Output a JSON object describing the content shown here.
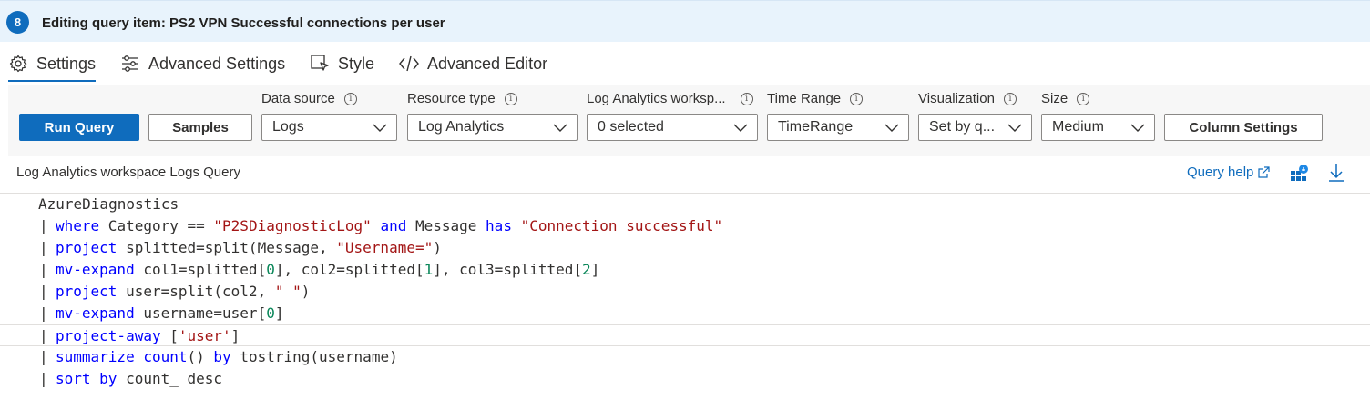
{
  "header": {
    "step": "8",
    "title": "Editing query item: PS2 VPN Successful connections per user"
  },
  "tabs": [
    {
      "label": "Settings",
      "icon": "gear-icon",
      "active": true
    },
    {
      "label": "Advanced Settings",
      "icon": "sliders-icon",
      "active": false
    },
    {
      "label": "Style",
      "icon": "cursor-box-icon",
      "active": false
    },
    {
      "label": "Advanced Editor",
      "icon": "code-icon",
      "active": false
    }
  ],
  "toolbar": {
    "run_label": "Run Query",
    "samples_label": "Samples",
    "column_settings_label": "Column Settings",
    "fields": [
      {
        "label": "Data source",
        "value": "Logs"
      },
      {
        "label": "Resource type",
        "value": "Log Analytics"
      },
      {
        "label": "Log Analytics worksp...",
        "value": "0 selected"
      },
      {
        "label": "Time Range",
        "value": "TimeRange"
      },
      {
        "label": "Visualization",
        "value": "Set by q..."
      },
      {
        "label": "Size",
        "value": "Medium"
      }
    ]
  },
  "query": {
    "title": "Log Analytics workspace Logs Query",
    "help_label": "Query help",
    "lines": [
      {
        "pipe": "",
        "tokens": [
          {
            "t": "AzureDiagnostics",
            "c": ""
          }
        ]
      },
      {
        "pipe": "|",
        "tokens": [
          {
            "t": "where",
            "c": "kw"
          },
          {
            "t": " Category == ",
            "c": ""
          },
          {
            "t": "\"P2SDiagnosticLog\"",
            "c": "str"
          },
          {
            "t": " ",
            "c": ""
          },
          {
            "t": "and",
            "c": "kw"
          },
          {
            "t": " Message ",
            "c": ""
          },
          {
            "t": "has",
            "c": "kw"
          },
          {
            "t": " ",
            "c": ""
          },
          {
            "t": "\"Connection successful\"",
            "c": "str"
          }
        ]
      },
      {
        "pipe": "|",
        "tokens": [
          {
            "t": "project",
            "c": "kw"
          },
          {
            "t": " splitted=split(Message, ",
            "c": ""
          },
          {
            "t": "\"Username=\"",
            "c": "str"
          },
          {
            "t": ")",
            "c": ""
          }
        ]
      },
      {
        "pipe": "|",
        "tokens": [
          {
            "t": "mv-expand",
            "c": "kw"
          },
          {
            "t": " col1=splitted[",
            "c": ""
          },
          {
            "t": "0",
            "c": "num"
          },
          {
            "t": "], col2=splitted[",
            "c": ""
          },
          {
            "t": "1",
            "c": "num"
          },
          {
            "t": "], col3=splitted[",
            "c": ""
          },
          {
            "t": "2",
            "c": "num"
          },
          {
            "t": "]",
            "c": ""
          }
        ]
      },
      {
        "pipe": "|",
        "tokens": [
          {
            "t": "project",
            "c": "kw"
          },
          {
            "t": " user=split(col2, ",
            "c": ""
          },
          {
            "t": "\" \"",
            "c": "str"
          },
          {
            "t": ")",
            "c": ""
          }
        ]
      },
      {
        "pipe": "|",
        "tokens": [
          {
            "t": "mv-expand",
            "c": "kw"
          },
          {
            "t": " username=user[",
            "c": ""
          },
          {
            "t": "0",
            "c": "num"
          },
          {
            "t": "]",
            "c": ""
          }
        ]
      },
      {
        "pipe": "|",
        "tokens": [
          {
            "t": "project-away",
            "c": "kw"
          },
          {
            "t": " [",
            "c": ""
          },
          {
            "t": "'user'",
            "c": "str"
          },
          {
            "t": "]",
            "c": ""
          }
        ]
      },
      {
        "pipe": "|",
        "tokens": [
          {
            "t": "summarize",
            "c": "kw"
          },
          {
            "t": " ",
            "c": ""
          },
          {
            "t": "count",
            "c": "kw"
          },
          {
            "t": "() ",
            "c": ""
          },
          {
            "t": "by",
            "c": "kw"
          },
          {
            "t": " tostring(username)",
            "c": ""
          }
        ]
      },
      {
        "pipe": "|",
        "tokens": [
          {
            "t": "sort",
            "c": "kw"
          },
          {
            "t": " ",
            "c": ""
          },
          {
            "t": "by",
            "c": "kw"
          },
          {
            "t": " count_ desc",
            "c": ""
          }
        ]
      }
    ]
  },
  "colors": {
    "accent": "#0f6cbd",
    "header_bg": "#e8f3fc",
    "keyword": "#0000ff",
    "string": "#a31515",
    "number": "#098658"
  }
}
